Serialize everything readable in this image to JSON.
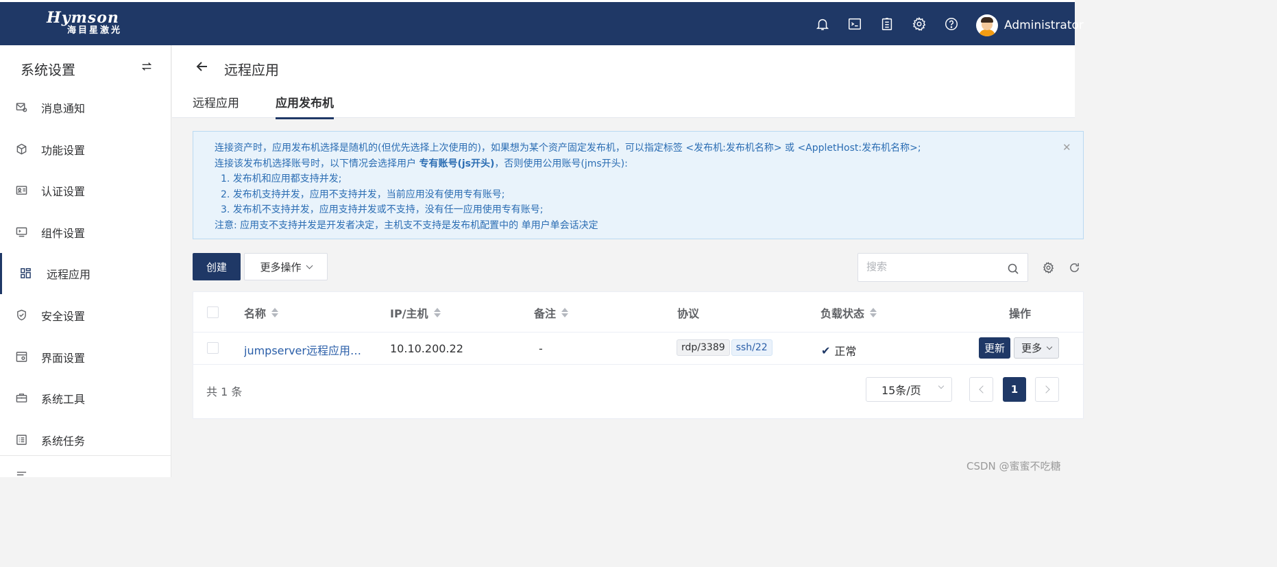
{
  "header": {
    "brand": "Hymson",
    "brand_sub": "海目星激光",
    "user_name": "Administrator"
  },
  "sidebar": {
    "title": "系统设置",
    "items": [
      {
        "label": "消息通知",
        "icon": "message-settings-icon"
      },
      {
        "label": "功能设置",
        "icon": "cube-icon"
      },
      {
        "label": "认证设置",
        "icon": "id-card-icon"
      },
      {
        "label": "组件设置",
        "icon": "terminal-screen-icon"
      },
      {
        "label": "远程应用",
        "icon": "apps-grid-icon",
        "active": true
      },
      {
        "label": "安全设置",
        "icon": "shield-check-icon"
      },
      {
        "label": "界面设置",
        "icon": "window-gear-icon"
      },
      {
        "label": "系统工具",
        "icon": "toolbox-icon"
      },
      {
        "label": "系统任务",
        "icon": "task-list-icon"
      }
    ]
  },
  "page": {
    "title": "远程应用",
    "tabs": [
      "远程应用",
      "应用发布机"
    ],
    "active_tab": "应用发布机"
  },
  "alert": {
    "line1": "连接资产时，应用发布机选择是随机的(但优先选择上次使用的)，如果想为某个资产固定发布机，可以指定标签 <发布机:发布机名称> 或 <AppletHost:发布机名称>;",
    "line2_pre": "连接该发布机选择账号时，以下情况会选择用户 ",
    "line2_bold": "专有账号(js开头)",
    "line2_post": "，否则使用公用账号(jms开头):",
    "line3": "1. 发布机和应用都支持并发;",
    "line4": "2. 发布机支持并发，应用不支持并发，当前应用没有使用专有账号;",
    "line5": "3. 发布机不支持并发，应用支持并发或不支持，没有任一应用使用专有账号;",
    "line6": "注意: 应用支不支持并发是开发者决定，主机支不支持是发布机配置中的 单用户单会话决定"
  },
  "toolbar": {
    "create_label": "创建",
    "more_label": "更多操作",
    "search_placeholder": "搜索"
  },
  "table": {
    "columns": [
      "名称",
      "IP/主机",
      "备注",
      "协议",
      "负载状态",
      "操作"
    ],
    "rows": [
      {
        "name": "jumpserver远程应用发…",
        "ip": "10.10.200.22",
        "comment": "-",
        "protocols": [
          "rdp/3389",
          "ssh/22"
        ],
        "status": "正常",
        "action_update": "更新",
        "action_more": "更多"
      }
    ]
  },
  "pagination": {
    "total": "共 1 条",
    "page_size": "15条/页",
    "current_page": "1"
  },
  "watermark": "CSDN @蜜蜜不吃糖",
  "colors": {
    "primary": "#1f3866",
    "link": "#2a5ea8",
    "alert_bg": "#e9f3fb"
  }
}
